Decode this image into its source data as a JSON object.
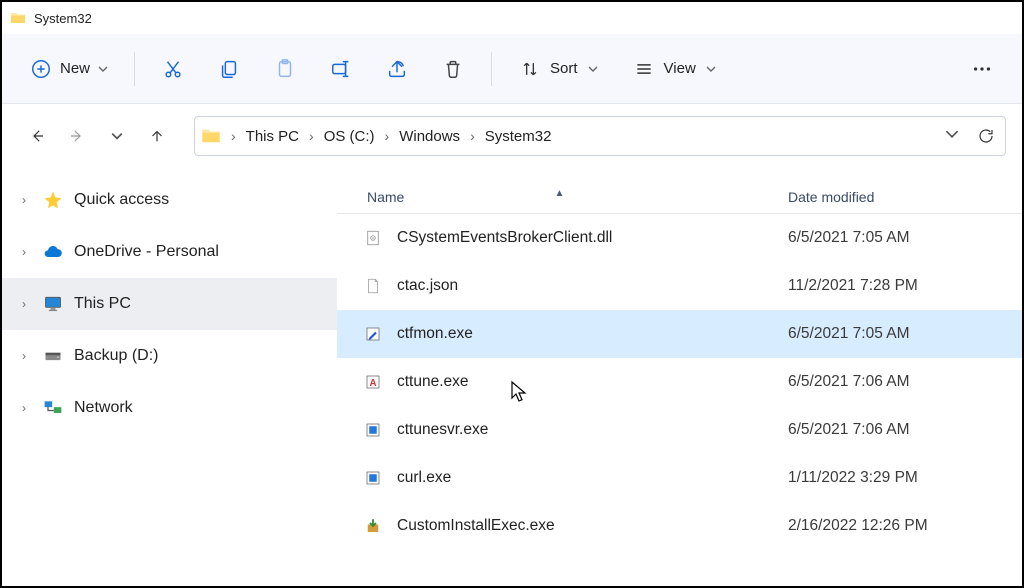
{
  "window": {
    "title": "System32"
  },
  "toolbar": {
    "new_label": "New",
    "sort_label": "Sort",
    "view_label": "View"
  },
  "breadcrumbs": {
    "items": [
      "This PC",
      "OS (C:)",
      "Windows",
      "System32"
    ]
  },
  "sidebar": {
    "items": [
      {
        "label": "Quick access",
        "icon": "star",
        "selected": false
      },
      {
        "label": "OneDrive - Personal",
        "icon": "cloud",
        "selected": false
      },
      {
        "label": "This PC",
        "icon": "monitor",
        "selected": true
      },
      {
        "label": "Backup (D:)",
        "icon": "drive",
        "selected": false
      },
      {
        "label": "Network",
        "icon": "network",
        "selected": false
      }
    ]
  },
  "columns": {
    "name": "Name",
    "date": "Date modified"
  },
  "files": [
    {
      "name": "CSystemEventsBrokerClient.dll",
      "date": "6/5/2021 7:05 AM",
      "icon": "dll",
      "selected": false
    },
    {
      "name": "ctac.json",
      "date": "11/2/2021 7:28 PM",
      "icon": "blank",
      "selected": false
    },
    {
      "name": "ctfmon.exe",
      "date": "6/5/2021 7:05 AM",
      "icon": "exe-pen",
      "selected": true
    },
    {
      "name": "cttune.exe",
      "date": "6/5/2021 7:06 AM",
      "icon": "exe-a",
      "selected": false
    },
    {
      "name": "cttunesvr.exe",
      "date": "6/5/2021 7:06 AM",
      "icon": "exe-generic",
      "selected": false
    },
    {
      "name": "curl.exe",
      "date": "1/11/2022 3:29 PM",
      "icon": "exe-generic",
      "selected": false
    },
    {
      "name": "CustomInstallExec.exe",
      "date": "2/16/2022 12:26 PM",
      "icon": "exe-install",
      "selected": false
    }
  ]
}
